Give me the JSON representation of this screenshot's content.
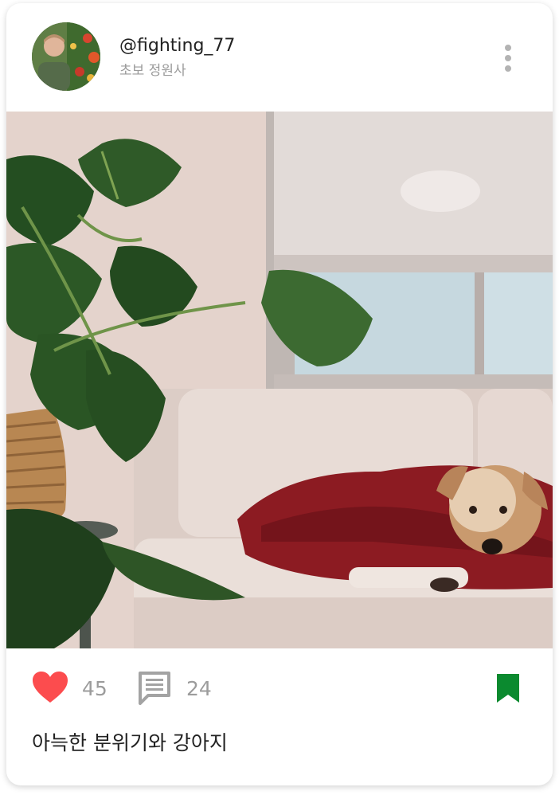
{
  "post": {
    "username": "@fighting_77",
    "subtitle": "초보 정원사",
    "like_count": "45",
    "comment_count": "24",
    "caption": "아늑한 분위기와 강아지"
  },
  "icons": {
    "more": "more-vertical-icon",
    "like": "heart-icon",
    "comment": "comment-icon",
    "bookmark": "bookmark-icon"
  },
  "colors": {
    "like": "#fc4c4e",
    "bookmark": "#0b8a2f",
    "counts": "#9c9c9c",
    "subtitle": "#9a9a9a"
  }
}
